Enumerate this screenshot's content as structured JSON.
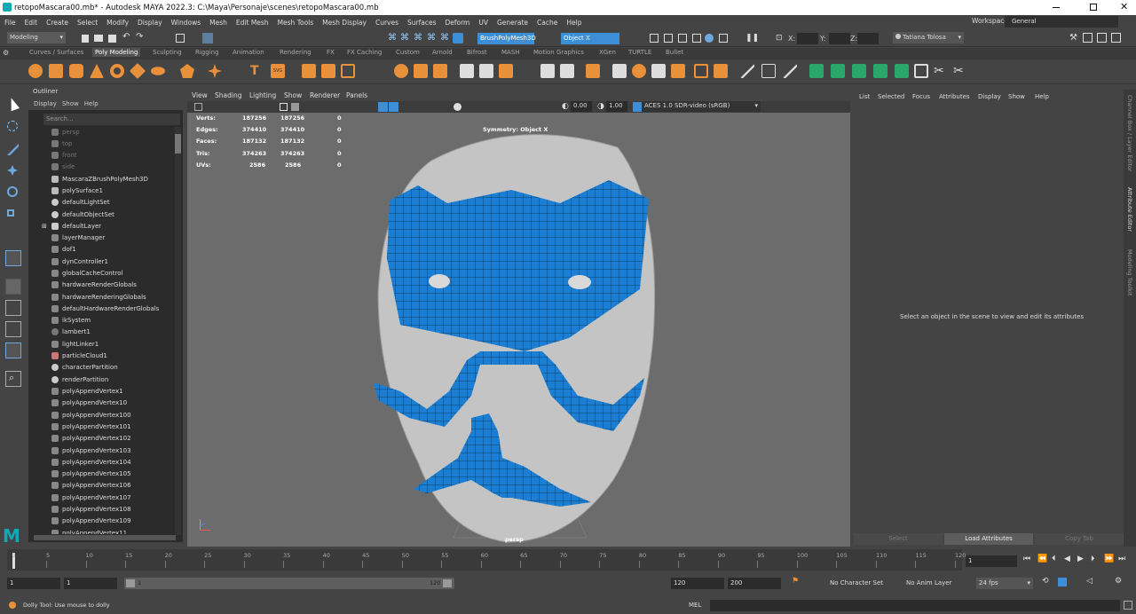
{
  "window": {
    "title": "retopoMascara00.mb* - Autodesk MAYA 2022.3: C:\\Maya\\Personaje\\scenes\\retopoMascara00.mb"
  },
  "menus": [
    "File",
    "Edit",
    "Create",
    "Select",
    "Modify",
    "Display",
    "Windows",
    "Mesh",
    "Edit Mesh",
    "Mesh Tools",
    "Mesh Display",
    "Curves",
    "Surfaces",
    "Deform",
    "UV",
    "Generate",
    "Cache",
    "Help"
  ],
  "workspace": {
    "label": "Workspace:",
    "value": "General"
  },
  "statusline": {
    "mode": "Modeling",
    "live_object": "BrushPolyMesh3D",
    "symmetry_field": "Object X",
    "x_label": "X:",
    "y_label": "Y:",
    "z_label": "Z:",
    "user": "Tatiana Tolosa"
  },
  "shelf_tabs": [
    "Curves / Surfaces",
    "Poly Modeling",
    "Sculpting",
    "Rigging",
    "Animation",
    "Rendering",
    "FX",
    "FX Caching",
    "Custom",
    "Arnold",
    "Bifrost",
    "MASH",
    "Motion Graphics",
    "XGen",
    "TURTLE",
    "Bullet"
  ],
  "shelf_active": "Poly Modeling",
  "outliner": {
    "title": "Outliner",
    "menu": [
      "Display",
      "Show",
      "Help"
    ],
    "search_placeholder": "Search...",
    "items": [
      "persp",
      "top",
      "front",
      "side",
      "MascaraZBrushPolyMesh3D",
      "polySurface1",
      "defaultLightSet",
      "defaultObjectSet",
      "defaultLayer",
      "layerManager",
      "dof1",
      "dynController1",
      "globalCacheControl",
      "hardwareRenderGlobals",
      "hardwareRenderingGlobals",
      "defaultHardwareRenderGlobals",
      "ikSystem",
      "lambert1",
      "lightLinker1",
      "particleCloud1",
      "characterPartition",
      "renderPartition",
      "polyAppendVertex1",
      "polyAppendVertex10",
      "polyAppendVertex100",
      "polyAppendVertex101",
      "polyAppendVertex102",
      "polyAppendVertex103",
      "polyAppendVertex104",
      "polyAppendVertex105",
      "polyAppendVertex106",
      "polyAppendVertex107",
      "polyAppendVertex108",
      "polyAppendVertex109",
      "polyAppendVertex11"
    ]
  },
  "viewport": {
    "menu": [
      "View",
      "Shading",
      "Lighting",
      "Show",
      "Renderer",
      "Panels"
    ],
    "exposure": "0.00",
    "gamma": "1.00",
    "colorspace": "ACES 1.0 SDR-video (sRGB)",
    "symmetry_label": "Symmetry: Object X",
    "camera_label": "persp",
    "hud": [
      {
        "label": "Verts:",
        "a": "187256",
        "b": "187256",
        "c": "0"
      },
      {
        "label": "Edges:",
        "a": "374410",
        "b": "374410",
        "c": "0"
      },
      {
        "label": "Faces:",
        "a": "187132",
        "b": "187132",
        "c": "0"
      },
      {
        "label": "Tris:",
        "a": "374263",
        "b": "374263",
        "c": "0"
      },
      {
        "label": "UVs:",
        "a": "2586",
        "b": "2586",
        "c": "0"
      }
    ]
  },
  "attribute_editor": {
    "menu": [
      "List",
      "Selected",
      "Focus",
      "Attributes",
      "Display",
      "Show",
      "Help"
    ],
    "message": "Select an object in the scene to view and edit its attributes",
    "buttons": [
      "Select",
      "Load Attributes",
      "Copy Tab"
    ]
  },
  "side_tabs": [
    "Channel Box / Layer Editor",
    "Attribute Editor",
    "Modeling Toolkit"
  ],
  "timeline": {
    "ticks": [
      "5",
      "10",
      "15",
      "20",
      "25",
      "30",
      "35",
      "40",
      "45",
      "50",
      "55",
      "60",
      "65",
      "70",
      "75",
      "80",
      "85",
      "90",
      "95",
      "100",
      "105",
      "110",
      "115",
      "120"
    ],
    "first": "1",
    "current_frame": "1"
  },
  "range": {
    "start": "1",
    "anim_start": "1",
    "slider_start": "1",
    "slider_end": "120",
    "end": "120",
    "anim_end": "200",
    "character_set": "No Character Set",
    "anim_layer": "No Anim Layer",
    "fps": "24 fps"
  },
  "helpline": {
    "text": "Dolly Tool: Use mouse to dolly",
    "lang": "MEL"
  },
  "colors": {
    "accent": "#3c8fd6",
    "mesh_blue": "#1a7fd4",
    "shelf_orange": "#e8913a"
  }
}
